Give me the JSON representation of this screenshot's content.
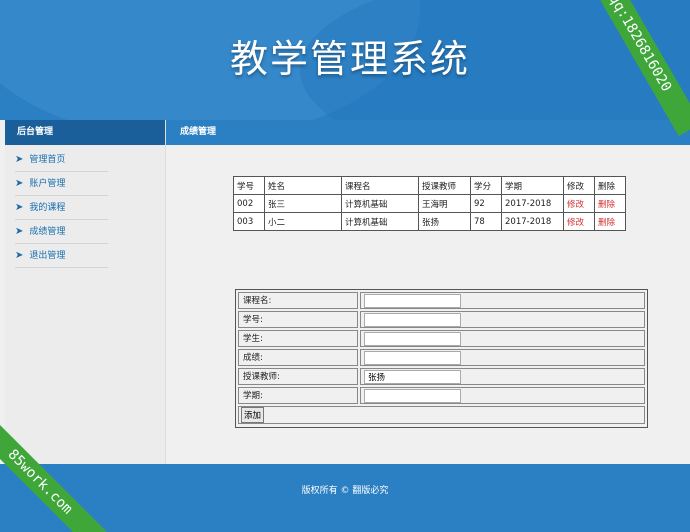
{
  "header": {
    "title": "教学管理系统"
  },
  "watermarks": {
    "qq": "qq:1826816020",
    "site": "85work.com"
  },
  "sidebar": {
    "title": "后台管理",
    "items": [
      {
        "label": "管理首页"
      },
      {
        "label": "账户管理"
      },
      {
        "label": "我的课程"
      },
      {
        "label": "成绩管理"
      },
      {
        "label": "退出管理"
      }
    ]
  },
  "content": {
    "title": "成绩管理"
  },
  "table": {
    "headers": [
      "学号",
      "姓名",
      "课程名",
      "授课教师",
      "学分",
      "学期",
      "修改",
      "删除"
    ],
    "rows": [
      [
        "002",
        "张三",
        "计算机基础",
        "王海明",
        "92",
        "2017-2018",
        "修改",
        "删除"
      ],
      [
        "003",
        "小二",
        "计算机基础",
        "张扬",
        "78",
        "2017-2018",
        "修改",
        "删除"
      ]
    ]
  },
  "form": {
    "course_label": "课程名:",
    "course_value": "",
    "id_label": "学号:",
    "id_value": "",
    "student_label": "学生:",
    "student_value": "",
    "score_label": "成绩:",
    "score_value": "",
    "teacher_label": "授课教师:",
    "teacher_value": "张扬",
    "term_label": "学期:",
    "term_value": "",
    "submit_label": "添加"
  },
  "footer": {
    "text": "版权所有 © 翻版必究"
  },
  "colors": {
    "primary": "#2b7fc3",
    "dark": "#1a5f99",
    "ribbon": "#3fa73a",
    "link_red": "#d43030"
  }
}
